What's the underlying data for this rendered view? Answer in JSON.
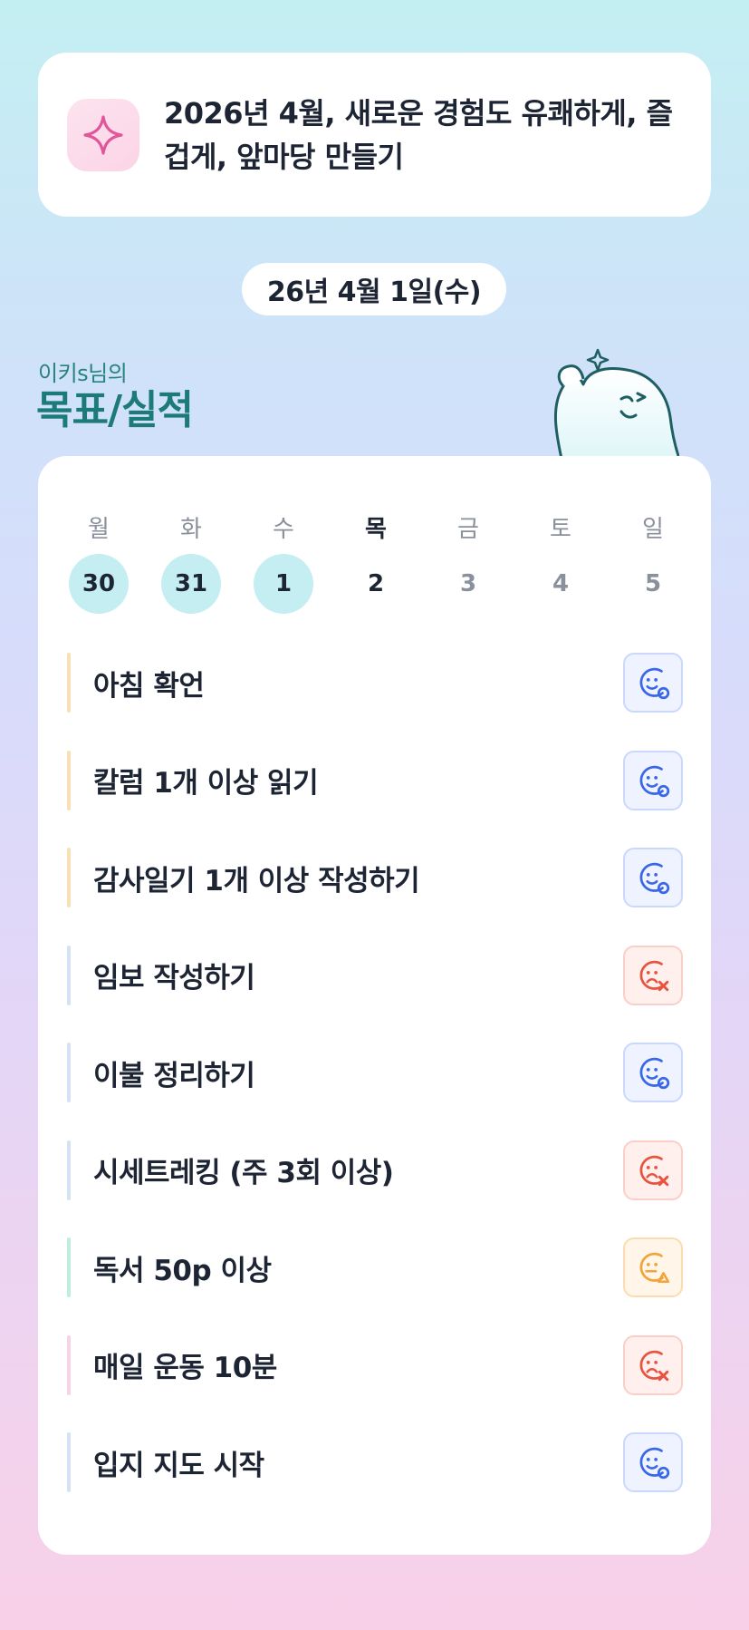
{
  "goal": {
    "icon": "sparkle-icon",
    "text_line1": "2026년 4월, 새로운 경험도 유쾌하게, 즐",
    "text_line2": "겁게, 앞마당 만들기"
  },
  "date": "26년 4월 1일(수)",
  "owner_label": "이키s님의",
  "section_title": "목표/실적",
  "mascot": "mascot-character-icon",
  "week": {
    "days": [
      {
        "name": "월",
        "num": "30",
        "state": "done"
      },
      {
        "name": "화",
        "num": "31",
        "state": "done"
      },
      {
        "name": "수",
        "num": "1",
        "state": "done"
      },
      {
        "name": "목",
        "num": "2",
        "state": "today"
      },
      {
        "name": "금",
        "num": "3",
        "state": "future"
      },
      {
        "name": "토",
        "num": "4",
        "state": "future"
      },
      {
        "name": "일",
        "num": "5",
        "state": "future"
      }
    ]
  },
  "tasks": [
    {
      "label": "아침 확언",
      "status": "success",
      "bar_color": "#f9e0b4"
    },
    {
      "label": "칼럼 1개 이상 읽기",
      "status": "success",
      "bar_color": "#f9e0b4"
    },
    {
      "label": "감사일기 1개 이상 작성하기",
      "status": "success",
      "bar_color": "#f9e0b4"
    },
    {
      "label": "임보 작성하기",
      "status": "fail",
      "bar_color": "#d5e2f4"
    },
    {
      "label": "이불 정리하기",
      "status": "success",
      "bar_color": "#d5e2f4"
    },
    {
      "label": "시세트레킹 (주 3회 이상)",
      "status": "fail",
      "bar_color": "#d5e2f4"
    },
    {
      "label": "독서 50p 이상",
      "status": "partial",
      "bar_color": "#bfeee1"
    },
    {
      "label": "매일 운동 10분",
      "status": "fail",
      "bar_color": "#f7d3e6"
    },
    {
      "label": "입지 지도 시작",
      "status": "success",
      "bar_color": "#d5e2f4"
    }
  ],
  "colors": {
    "success": "#3a66e8",
    "fail": "#e8533f",
    "partial": "#f2a33a",
    "accent_teal": "#1c7a78"
  }
}
